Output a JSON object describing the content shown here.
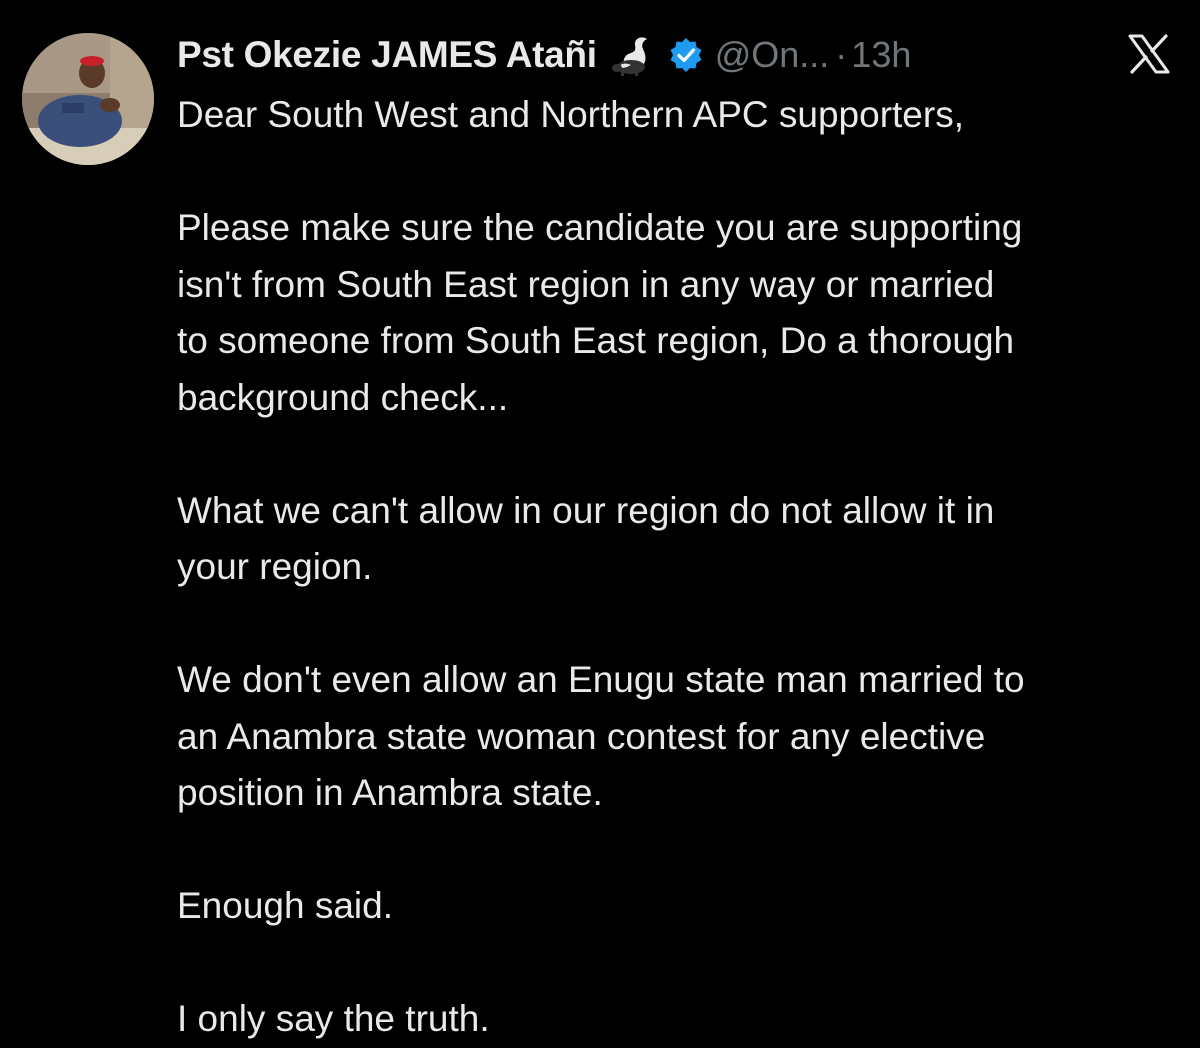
{
  "tweet": {
    "display_name": "Pst Okezie JAMES Atañi",
    "name_emoji": "skunk-icon",
    "verified": true,
    "handle": "@On...",
    "separator": "·",
    "time": "13h",
    "platform_icon": "x-logo-icon",
    "colors": {
      "background": "#000000",
      "text": "#e7e9ea",
      "secondary": "#71767b",
      "verified_badge": "#1d9bf0"
    },
    "lines": [
      [
        "Dear South West and Northern APC supporters,"
      ],
      [
        "Please make sure the candidate you are supporting",
        "isn't from South East region in any way or married",
        "to someone from South East region, Do a thorough",
        "background check..."
      ],
      [
        "What we can't allow in our region do not allow it in",
        "your region."
      ],
      [
        "We don't even allow an Enugu state man married to",
        "an Anambra state woman contest for any elective",
        "position in Anambra state."
      ],
      [
        "Enough said."
      ],
      [
        "I only say the truth."
      ]
    ]
  }
}
